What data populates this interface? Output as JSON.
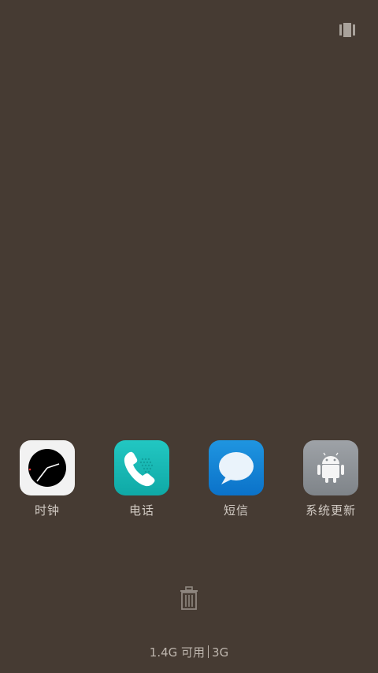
{
  "status": {
    "recent_icon": "recent-apps-icon"
  },
  "apps": [
    {
      "label": "时钟",
      "icon": "clock-icon"
    },
    {
      "label": "电话",
      "icon": "phone-icon"
    },
    {
      "label": "短信",
      "icon": "message-icon"
    },
    {
      "label": "系统更新",
      "icon": "android-icon"
    }
  ],
  "footer": {
    "trash_icon": "trash-icon",
    "memory_text": "1.4G 可用",
    "network_text": "3G"
  }
}
